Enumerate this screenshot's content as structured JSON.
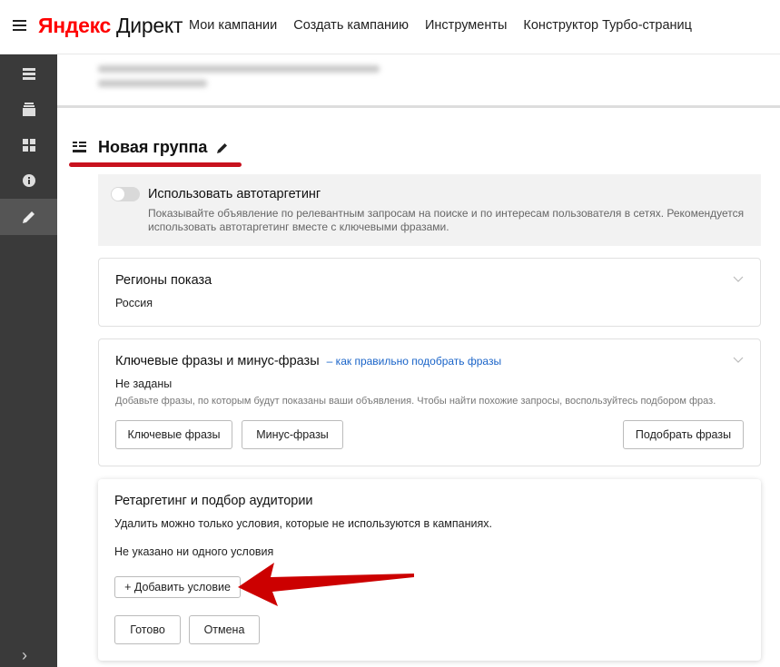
{
  "header": {
    "logo_yandex": "Яндекс",
    "logo_direct": "Директ",
    "nav": [
      "Мои кампании",
      "Создать кампанию",
      "Инструменты",
      "Конструктор Турбо-страниц"
    ]
  },
  "sidebar": {
    "items": [
      "menu-list-icon",
      "stack-icon",
      "grid-icon",
      "info-icon",
      "pencil-icon"
    ],
    "active": "pencil-icon"
  },
  "group": {
    "title": "Новая группа"
  },
  "autotargeting": {
    "title": "Использовать автотаргетинг",
    "description": "Показывайте объявление по релевантным запросам на поиске и по интересам пользователя в сетях. Рекомендуется использовать автотаргетинг вместе с ключевыми фразами."
  },
  "regions": {
    "title": "Регионы показа",
    "value": "Россия"
  },
  "keywords": {
    "title": "Ключевые фразы и минус-фразы",
    "link": "– как правильно подобрать фразы",
    "status": "Не заданы",
    "hint": "Добавьте фразы, по которым будут показаны ваши объявления. Чтобы найти похожие запросы, воспользуйтесь подбором фраз.",
    "btn_keywords": "Ключевые фразы",
    "btn_minus": "Минус-фразы",
    "btn_pick": "Подобрать фразы"
  },
  "retargeting": {
    "title": "Ретаргетинг и подбор аудитории",
    "note": "Удалить можно только условия, которые не используются в кампаниях.",
    "empty": "Не указано ни одного условия",
    "btn_add": "+ Добавить условие",
    "btn_done": "Готово",
    "btn_cancel": "Отмена"
  },
  "colors": {
    "accent_red": "#c8121e",
    "link_blue": "#1a64c8",
    "sidebar_bg": "#3a3a3a"
  }
}
